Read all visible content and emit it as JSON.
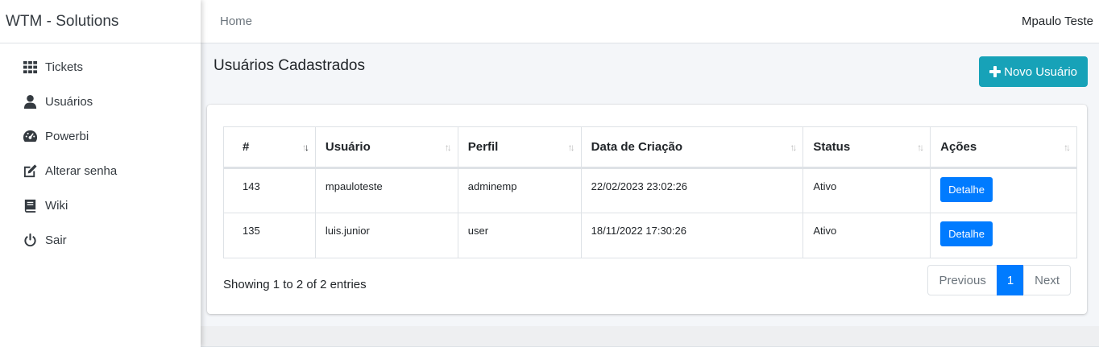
{
  "brand": "WTM - Solutions",
  "sidebar": {
    "items": [
      {
        "label": "Tickets",
        "icon": "grid-icon"
      },
      {
        "label": "Usuários",
        "icon": "user-icon"
      },
      {
        "label": "Powerbi",
        "icon": "gauge-icon"
      },
      {
        "label": "Alterar senha",
        "icon": "edit-icon"
      },
      {
        "label": "Wiki",
        "icon": "book-icon"
      },
      {
        "label": "Sair",
        "icon": "power-icon"
      }
    ]
  },
  "topbar": {
    "home": "Home",
    "user": "Mpaulo Teste"
  },
  "page": {
    "title": "Usuários Cadastrados",
    "new_button": "Novo Usuário"
  },
  "table": {
    "headers": [
      "#",
      "Usuário",
      "Perfil",
      "Data de Criação",
      "Status",
      "Ações"
    ],
    "rows": [
      {
        "id": "143",
        "usuario": "mpauloteste",
        "perfil": "adminemp",
        "data": "22/02/2023 23:02:26",
        "status": "Ativo",
        "acao": "Detalhe"
      },
      {
        "id": "135",
        "usuario": "luis.junior",
        "perfil": "user",
        "data": "18/11/2022 17:30:26",
        "status": "Ativo",
        "acao": "Detalhe"
      }
    ]
  },
  "footer": {
    "info": "Showing 1 to 2 of 2 entries",
    "previous": "Previous",
    "page": "1",
    "next": "Next"
  },
  "colors": {
    "accent": "#17a2b8",
    "primary": "#007bff"
  }
}
